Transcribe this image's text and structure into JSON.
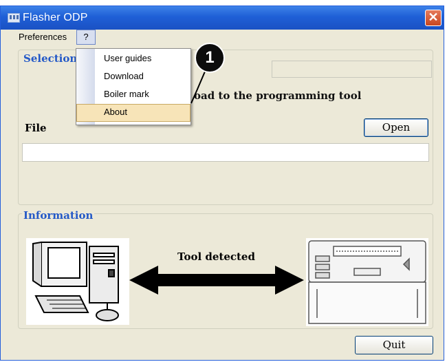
{
  "window": {
    "title": "Flasher ODP",
    "close_glyph": "✕"
  },
  "menubar": {
    "preferences": "Preferences",
    "help": "?"
  },
  "dropdown": {
    "items": [
      {
        "label": "User guides"
      },
      {
        "label": "Download"
      },
      {
        "label": "Boiler mark"
      },
      {
        "label": "About"
      }
    ],
    "highlighted": "About"
  },
  "selection": {
    "title": "Selection",
    "hint": "oad to the programming tool",
    "file_label": "File",
    "open_button": "Open",
    "file_value": ""
  },
  "information": {
    "title": "Information",
    "tool_status": "Tool detected"
  },
  "quit_button": "Quit",
  "callout": {
    "number": "1"
  },
  "icons": [
    "app-icon",
    "close-icon",
    "computer-icon",
    "double-arrow-icon",
    "programming-tool-icon"
  ],
  "colors": {
    "accent": "#2459c7",
    "titlebar": "#1f5fd6",
    "highlight": "#f7e4b8"
  }
}
